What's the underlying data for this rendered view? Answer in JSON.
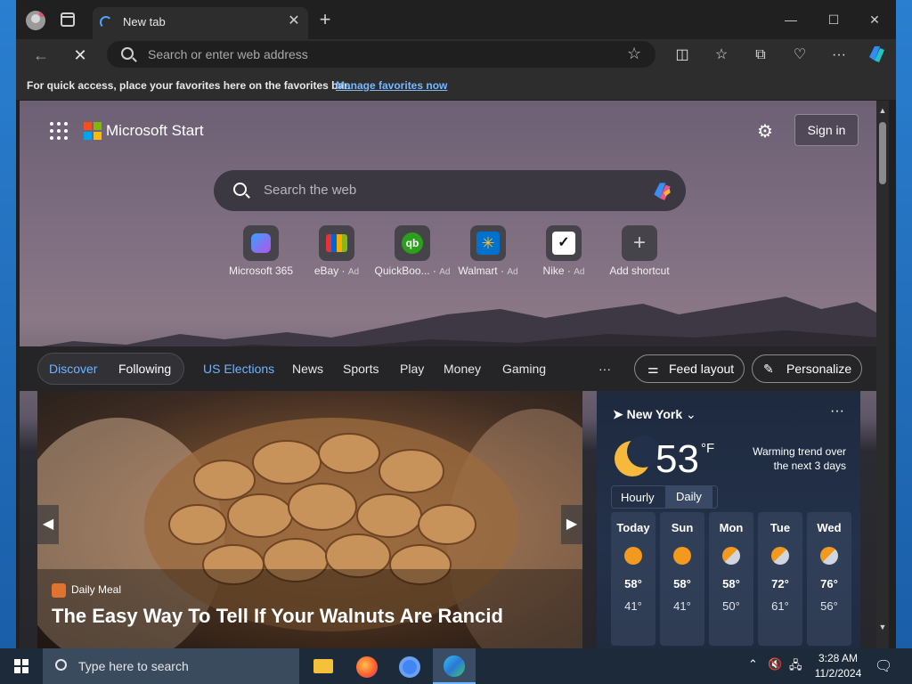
{
  "browser": {
    "tab_title": "New tab",
    "address_placeholder": "Search or enter web address",
    "favorites_message": "For quick access, place your favorites here on the favorites bar.",
    "favorites_link": "Manage favorites now"
  },
  "page": {
    "brand": "Microsoft Start",
    "sign_in": "Sign in",
    "search_placeholder": "Search the web",
    "shortcuts": [
      {
        "label": "Microsoft 365",
        "ad": ""
      },
      {
        "label": "eBay",
        "ad": "Ad"
      },
      {
        "label": "QuickBoo...",
        "ad": "Ad"
      },
      {
        "label": "Walmart",
        "ad": "Ad"
      },
      {
        "label": "Nike",
        "ad": "Ad"
      },
      {
        "label": "Add shortcut",
        "ad": ""
      }
    ]
  },
  "feed": {
    "discover": "Discover",
    "following": "Following",
    "tabs": [
      "US Elections",
      "News",
      "Sports",
      "Play",
      "Money",
      "Gaming"
    ],
    "more": "···",
    "feed_layout": "Feed layout",
    "personalize": "Personalize",
    "hero": {
      "source": "Daily Meal",
      "headline": "The Easy Way To Tell If Your Walnuts Are Rancid"
    }
  },
  "weather": {
    "location": "New York",
    "temp": "53",
    "unit": "°F",
    "trend": "Warming trend over the next 3 days",
    "hourly": "Hourly",
    "daily": "Daily",
    "days": [
      {
        "name": "Today",
        "hi": "58°",
        "lo": "41°"
      },
      {
        "name": "Sun",
        "hi": "58°",
        "lo": "41°"
      },
      {
        "name": "Mon",
        "hi": "58°",
        "lo": "50°"
      },
      {
        "name": "Tue",
        "hi": "72°",
        "lo": "61°"
      },
      {
        "name": "Wed",
        "hi": "76°",
        "lo": "56°"
      }
    ]
  },
  "taskbar": {
    "search_placeholder": "Type here to search",
    "time": "3:28 AM",
    "date": "11/2/2024"
  }
}
